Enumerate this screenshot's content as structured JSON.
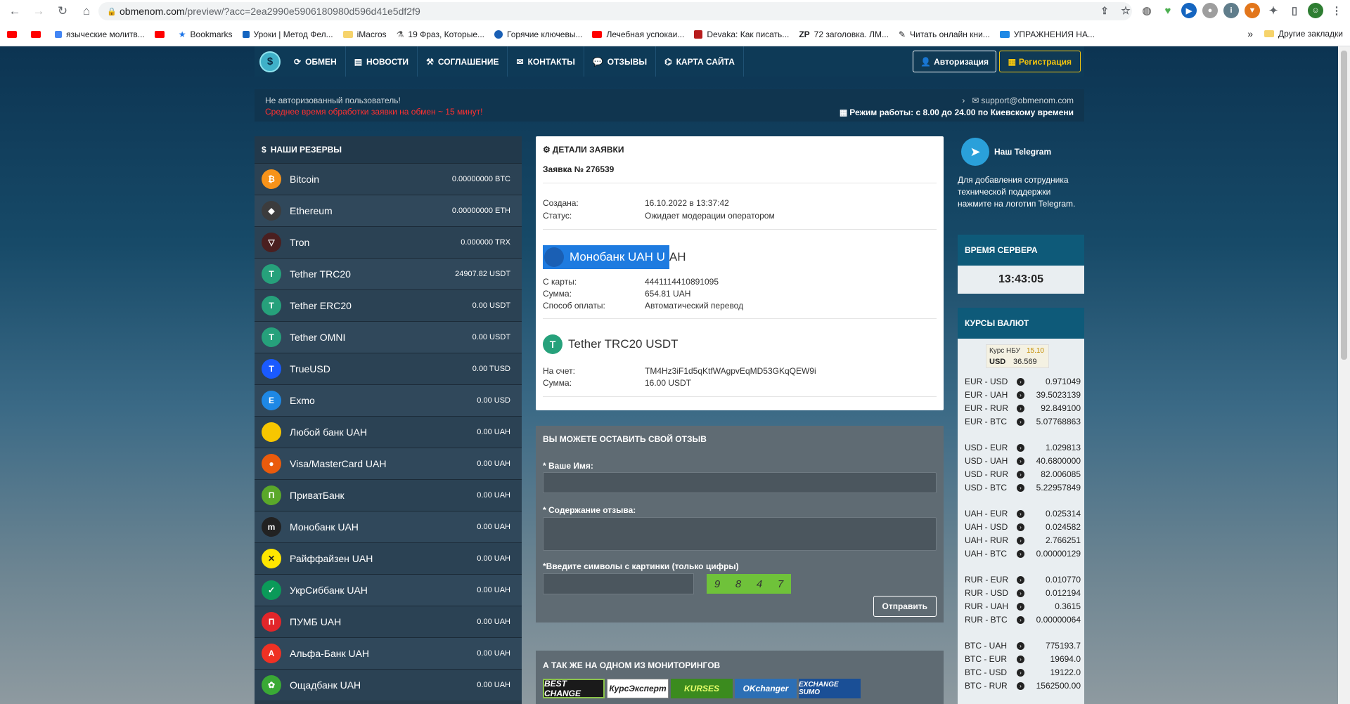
{
  "browser": {
    "url_host": "obmenom.com",
    "url_path": "/preview/?acc=2ea2990e5906180980d596d41e5df2f9",
    "bookmarks": [
      "языческие молитв...",
      "Bookmarks",
      "Уроки | Метод Фел...",
      "iMacros",
      "19 Фраз, Которые...",
      "Горячие ключевы...",
      "Лечебная успокаи...",
      "Devaka: Как писать...",
      "72 заголовка. ЛМ...",
      "Читать онлайн кни...",
      "УПРАЖНЕНИЯ НА..."
    ],
    "bm_prefix_zp": "ZP",
    "other_bookmarks": "Другие закладки",
    "more": "»"
  },
  "nav": {
    "items": [
      "ОБМЕН",
      "НОВОСТИ",
      "СОГЛАШЕНИЕ",
      "КОНТАКТЫ",
      "ОТЗЫВЫ",
      "КАРТА САЙТА"
    ],
    "auth": "Авторизация",
    "register": "Регистрация"
  },
  "infobar": {
    "user": "Не авторизованный пользователь!",
    "avg_time": "Среднее время обработки заявки на обмен ~ 15 минут!",
    "email": "support@obmenom.com",
    "hours": "Режим работы: с 8.00 до 24.00 по Киевскому времени"
  },
  "reserves": {
    "title": "НАШИ РЕЗЕРВЫ",
    "items": [
      {
        "name": "Bitcoin",
        "amount": "0.00000000 BTC",
        "color": "#f7931a",
        "glyph": "₿"
      },
      {
        "name": "Ethereum",
        "amount": "0.00000000 ETH",
        "color": "#3c3c3d",
        "glyph": "◆"
      },
      {
        "name": "Tron",
        "amount": "0.000000 TRX",
        "color": "#4a1f20",
        "glyph": "▽"
      },
      {
        "name": "Tether TRC20",
        "amount": "24907.82 USDT",
        "color": "#26a17b",
        "glyph": "T"
      },
      {
        "name": "Tether ERC20",
        "amount": "0.00 USDT",
        "color": "#26a17b",
        "glyph": "T"
      },
      {
        "name": "Tether OMNI",
        "amount": "0.00 USDT",
        "color": "#26a17b",
        "glyph": "T"
      },
      {
        "name": "TrueUSD",
        "amount": "0.00 TUSD",
        "color": "#1a5aff",
        "glyph": "T"
      },
      {
        "name": "Exmo",
        "amount": "0.00 USD",
        "color": "#1e88e5",
        "glyph": "E"
      },
      {
        "name": "Любой банк UAH",
        "amount": "0.00 UAH",
        "color": "#f7c600",
        "glyph": ""
      },
      {
        "name": "Visa/MasterCard UAH",
        "amount": "0.00 UAH",
        "color": "#ea5b0c",
        "glyph": "●"
      },
      {
        "name": "ПриватБанк",
        "amount": "0.00 UAH",
        "color": "#5aa82a",
        "glyph": "П"
      },
      {
        "name": "Монобанк UAH",
        "amount": "0.00 UAH",
        "color": "#222222",
        "glyph": "m"
      },
      {
        "name": "Райффайзен UAH",
        "amount": "0.00 UAH",
        "color": "#ffe600",
        "glyph": "✕"
      },
      {
        "name": "УкрСиббанк UAH",
        "amount": "0.00 UAH",
        "color": "#0b9a59",
        "glyph": "✓"
      },
      {
        "name": "ПУМБ UAH",
        "amount": "0.00 UAH",
        "color": "#e2262a",
        "glyph": "П"
      },
      {
        "name": "Альфа-Банк UAH",
        "amount": "0.00 UAH",
        "color": "#ef3124",
        "glyph": "A"
      },
      {
        "name": "Ощадбанк UAH",
        "amount": "0.00 UAH",
        "color": "#3aa935",
        "glyph": "✿"
      }
    ]
  },
  "details": {
    "title": "ДЕТАЛИ ЗАЯВКИ",
    "number": "Заявка № 276539",
    "created_label": "Создана:",
    "created": "16.10.2022 в 13:37:42",
    "status_label": "Статус:",
    "status": "Ожидает модерации оператором",
    "from_title_sel": "Монобанк UAH U",
    "from_title_rest": "AH",
    "card_label": "С карты:",
    "card": "4441114410891095",
    "sum_label": "Сумма:",
    "sum_from": "654.81 UAH",
    "pay_label": "Способ оплаты:",
    "pay": "Автоматический перевод",
    "to_title": "Tether TRC20 USDT",
    "account_label": "На счет:",
    "account": "TM4Hz3iF1d5qKtfWAgpvEqMD53GKqQEW9i",
    "sum_to": "16.00 USDT"
  },
  "review": {
    "title": "ВЫ МОЖЕТЕ ОСТАВИТЬ СВОЙ ОТЗЫВ",
    "name_label": "* Ваше Имя:",
    "content_label": "* Содержание отзыва:",
    "captcha_label": "*Введите символы с картинки (только цифры)",
    "captcha_digits": [
      "9",
      "8",
      "4",
      "7"
    ],
    "send": "Отправить"
  },
  "monitors": {
    "title": "А ТАК ЖЕ НА ОДНОМ ИЗ МОНИТОРИНГОВ",
    "items": [
      "BEST CHANGE",
      "КурсЭксперт",
      "KURSES",
      "OKchanger",
      "EXCHANGE SUMO"
    ]
  },
  "telegram": {
    "name": "Наш Telegram",
    "desc": "Для добавления сотрудника технической поддержки нажмите на логотип Telegram."
  },
  "server_time": {
    "title": "ВРЕМЯ СЕРВЕРА",
    "value": "13:43:05"
  },
  "rates": {
    "title": "КУРСЫ ВАЛЮТ",
    "nbu_title": "Курс НБУ",
    "nbu_date": "15.10",
    "nbu_currency": "USD",
    "nbu_value": "36.569",
    "groups": [
      [
        [
          "EUR - USD",
          "0.971049"
        ],
        [
          "EUR - UAH",
          "39.5023139"
        ],
        [
          "EUR - RUR",
          "92.849100"
        ],
        [
          "EUR - BTC",
          "5.07768863"
        ]
      ],
      [
        [
          "USD - EUR",
          "1.029813"
        ],
        [
          "USD - UAH",
          "40.6800000"
        ],
        [
          "USD - RUR",
          "82.006085"
        ],
        [
          "USD - BTC",
          "5.22957849"
        ]
      ],
      [
        [
          "UAH - EUR",
          "0.025314"
        ],
        [
          "UAH - USD",
          "0.024582"
        ],
        [
          "UAH - RUR",
          "2.766251"
        ],
        [
          "UAH - BTC",
          "0.00000129"
        ]
      ],
      [
        [
          "RUR - EUR",
          "0.010770"
        ],
        [
          "RUR - USD",
          "0.012194"
        ],
        [
          "RUR - UAH",
          "0.3615"
        ],
        [
          "RUR - BTC",
          "0.00000064"
        ]
      ],
      [
        [
          "BTC - UAH",
          "775193.7"
        ],
        [
          "BTC - EUR",
          "19694.0"
        ],
        [
          "BTC - USD",
          "19122.0"
        ],
        [
          "BTC - RUR",
          "1562500.00"
        ]
      ]
    ]
  }
}
